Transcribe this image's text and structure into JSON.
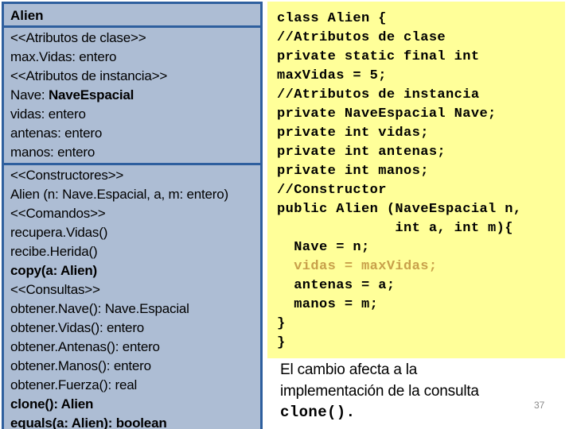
{
  "uml_class": {
    "name": "Alien",
    "attributes": [
      {
        "text": "<<Atributos de clase>>",
        "bold": false
      },
      {
        "text": "max.Vidas: entero",
        "bold": false
      },
      {
        "text": "<<Atributos de instancia>>",
        "bold": false
      },
      {
        "text": "Nave: NaveEspacial",
        "bold": false,
        "bold_from": "NaveEspacial"
      },
      {
        "text": "vidas: entero",
        "bold": false
      },
      {
        "text": "antenas: entero",
        "bold": false
      },
      {
        "text": "manos: entero",
        "bold": false
      }
    ],
    "operations": [
      {
        "text": "<<Constructores>>",
        "bold": false
      },
      {
        "text": "Alien (n: Nave.Espacial, a, m: entero)",
        "bold": false
      },
      {
        "text": "<<Comandos>>",
        "bold": false
      },
      {
        "text": "recupera.Vidas()",
        "bold": false
      },
      {
        "text": "recibe.Herida()",
        "bold": false
      },
      {
        "text": "copy(a: Alien)",
        "bold": true
      },
      {
        "text": "<<Consultas>>",
        "bold": false
      },
      {
        "text": "obtener.Nave(): Nave.Espacial",
        "bold": false
      },
      {
        "text": "obtener.Vidas(): entero",
        "bold": false
      },
      {
        "text": "obtener.Antenas(): entero",
        "bold": false
      },
      {
        "text": "obtener.Manos(): entero",
        "bold": false
      },
      {
        "text": "obtener.Fuerza(): real",
        "bold": false
      },
      {
        "text": "clone(): Alien",
        "bold": true
      },
      {
        "text": "equals(a: Alien): boolean",
        "bold": true
      }
    ]
  },
  "code_panel": {
    "lines": [
      {
        "text": "class Alien {",
        "highlight": false
      },
      {
        "text": "//Atributos de clase",
        "highlight": false
      },
      {
        "text": "private static final int",
        "highlight": false
      },
      {
        "text": "maxVidas = 5;",
        "highlight": false
      },
      {
        "text": "//Atributos de instancia",
        "highlight": false
      },
      {
        "text": "private NaveEspacial Nave;",
        "highlight": false
      },
      {
        "text": "private int vidas;",
        "highlight": false
      },
      {
        "text": "private int antenas;",
        "highlight": false
      },
      {
        "text": "private int manos;",
        "highlight": false
      },
      {
        "text": "//Constructor",
        "highlight": false
      },
      {
        "text": "public Alien (NaveEspacial n,",
        "highlight": false
      },
      {
        "text": "              int a, int m){",
        "highlight": false
      },
      {
        "text": "  Nave = n;",
        "highlight": false
      },
      {
        "text": "  vidas = maxVidas;",
        "highlight": true
      },
      {
        "text": "  antenas = a;",
        "highlight": false
      },
      {
        "text": "  manos = m;",
        "highlight": false
      },
      {
        "text": "}",
        "highlight": false
      },
      {
        "text": "}",
        "highlight": false
      }
    ]
  },
  "caption": {
    "lines": [
      {
        "text": "El cambio afecta a la",
        "mono": false
      },
      {
        "text": "implementación de la consulta",
        "mono": false
      },
      {
        "text": "clone().",
        "mono": true
      }
    ]
  },
  "page_number": "37",
  "colors": {
    "uml_fill": "#adbdd4",
    "uml_border": "#2e5f9e",
    "code_fill": "#ffff99",
    "code_highlight": "#c8a04a",
    "page_number": "#8a8a8a"
  }
}
